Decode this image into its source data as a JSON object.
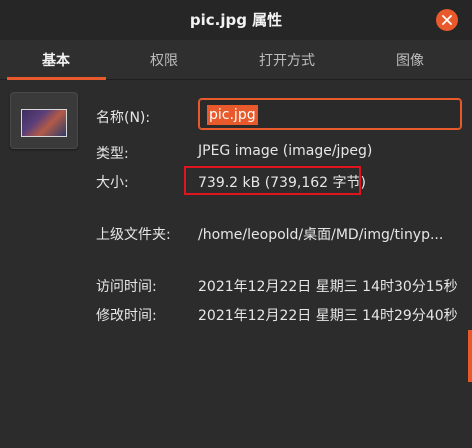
{
  "window": {
    "title": "pic.jpg 属性",
    "accent": "#e8592c"
  },
  "tabs": [
    {
      "label": "基本",
      "active": true
    },
    {
      "label": "权限",
      "active": false
    },
    {
      "label": "打开方式",
      "active": false
    },
    {
      "label": "图像",
      "active": false
    }
  ],
  "thumbnail": {
    "icon": "image-thumbnail"
  },
  "fields": {
    "name": {
      "label": "名称(N):",
      "value": "pic.jpg"
    },
    "type": {
      "label": "类型:",
      "value": "JPEG image (image/jpeg)"
    },
    "size": {
      "label": "大小:",
      "value": "739.2 kB (739,162 字节)"
    },
    "parent": {
      "label": "上级文件夹:",
      "value": "/home/leopold/桌面/MD/img/tinyp..."
    },
    "accessed": {
      "label": "访问时间:",
      "value": "2021年12月22日 星期三 14时30分15秒"
    },
    "modified": {
      "label": "修改时间:",
      "value": "2021年12月22日 星期三 14时29分40秒"
    }
  },
  "highlight_color": "#e0141e"
}
